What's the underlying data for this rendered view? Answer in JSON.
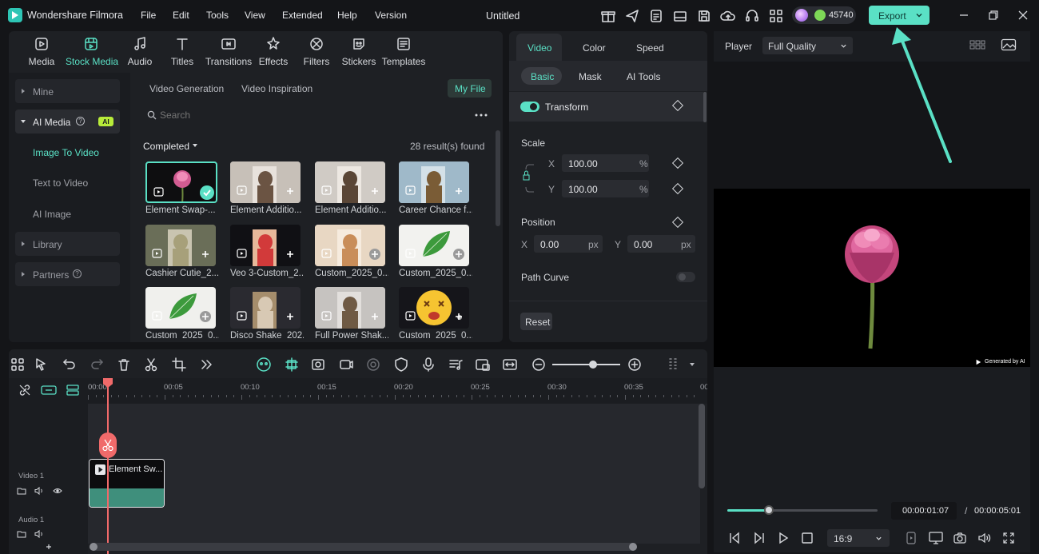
{
  "titlebar": {
    "app": "Wondershare Filmora",
    "menu": [
      "File",
      "Edit",
      "Tools",
      "View",
      "Extended",
      "Help",
      "Version"
    ],
    "project": "Untitled",
    "credits": "45740",
    "export": "Export"
  },
  "tabs": [
    {
      "label": "Media",
      "icon": "media-icon"
    },
    {
      "label": "Stock Media",
      "icon": "stock-media-icon",
      "active": true
    },
    {
      "label": "Audio",
      "icon": "music-note-icon"
    },
    {
      "label": "Titles",
      "icon": "text-t-icon"
    },
    {
      "label": "Transitions",
      "icon": "transitions-icon"
    },
    {
      "label": "Effects",
      "icon": "effects-icon"
    },
    {
      "label": "Filters",
      "icon": "filters-icon"
    },
    {
      "label": "Stickers",
      "icon": "stickers-icon"
    },
    {
      "label": "Templates",
      "icon": "templates-icon"
    }
  ],
  "sidebar": {
    "mine": "Mine",
    "ai_media": "AI Media",
    "ai_badge": "AI",
    "image_to_video": "Image To Video",
    "text_to_video": "Text to Video",
    "ai_image": "AI Image",
    "library": "Library",
    "partners": "Partners"
  },
  "media": {
    "subtab1": "Video Generation",
    "subtab2": "Video Inspiration",
    "my_file": "My File",
    "search_placeholder": "Search",
    "filter": "Completed",
    "results": "28 result(s) found",
    "items": [
      "Element Swap-...",
      "Element Additio...",
      "Element Additio...",
      "Career Chance f...",
      "Cashier Cutie_2...",
      "Veo 3-Custom_2...",
      "Custom_2025_0...",
      "Custom_2025_0...",
      "Custom_2025_0...",
      "Disco Shake_202...",
      "Full Power Shak...",
      "Custom_2025_0..."
    ]
  },
  "props": {
    "tab_video": "Video",
    "tab_color": "Color",
    "tab_speed": "Speed",
    "sub_basic": "Basic",
    "sub_mask": "Mask",
    "sub_ai": "AI Tools",
    "transform": "Transform",
    "scale": "Scale",
    "x": "X",
    "y": "Y",
    "scale_x": "100.00",
    "scale_y": "100.00",
    "pct": "%",
    "position": "Position",
    "pos_x": "0.00",
    "pos_y": "0.00",
    "px": "px",
    "path_curve": "Path Curve",
    "reset": "Reset"
  },
  "player": {
    "label": "Player",
    "quality": "Full Quality",
    "watermark": "Generated by AI",
    "current": "00:00:01:07",
    "sep": "/",
    "total": "00:00:05:01",
    "aspect": "16:9",
    "progress": 0.27
  },
  "timeline": {
    "ruler": [
      "00:00",
      "00:05",
      "00:10",
      "00:15",
      "00:20",
      "00:25",
      "00:30",
      "00:35",
      "00"
    ],
    "video_track": "Video 1",
    "audio_track": "Audio 1",
    "clip": "Element Sw...",
    "zoom": 0.6
  }
}
